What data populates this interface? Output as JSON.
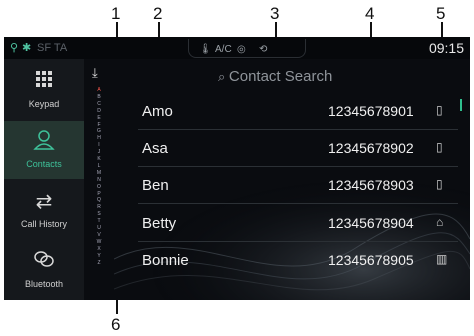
{
  "callouts": [
    "1",
    "2",
    "3",
    "4",
    "5",
    "6"
  ],
  "statusbar": {
    "left_text": "SF TA",
    "climate_label": "A/C",
    "clock": "09:15"
  },
  "sidebar": {
    "items": [
      {
        "label": "Keypad",
        "icon": "keypad-icon"
      },
      {
        "label": "Contacts",
        "icon": "person-icon",
        "active": true
      },
      {
        "label": "Call History",
        "icon": "swap-arrows-icon"
      },
      {
        "label": "Bluetooth",
        "icon": "link-icon"
      }
    ]
  },
  "alphabet": [
    "A",
    "B",
    "C",
    "D",
    "E",
    "F",
    "G",
    "H",
    "I",
    "J",
    "K",
    "L",
    "M",
    "N",
    "O",
    "P",
    "Q",
    "R",
    "S",
    "T",
    "U",
    "V",
    "W",
    "X",
    "Y",
    "Z"
  ],
  "alphabet_selected": "A",
  "search": {
    "placeholder": "Contact Search"
  },
  "contacts": [
    {
      "name": "Amo",
      "phone": "12345678901",
      "type": "mobile-icon"
    },
    {
      "name": "Asa",
      "phone": "12345678902",
      "type": "mobile-icon"
    },
    {
      "name": "Ben",
      "phone": "12345678903",
      "type": "mobile-icon"
    },
    {
      "name": "Betty",
      "phone": "12345678904",
      "type": "home-icon"
    },
    {
      "name": "Bonnie",
      "phone": "12345678905",
      "type": "office-icon"
    }
  ],
  "colors": {
    "accent": "#3ec29a",
    "alpha_selected": "#ff5a4e"
  }
}
